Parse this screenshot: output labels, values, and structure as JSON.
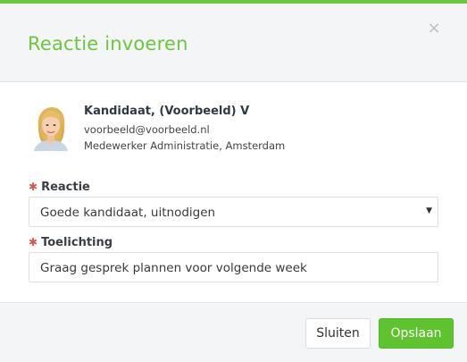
{
  "dialog": {
    "title": "Reactie invoeren",
    "close_glyph": "×",
    "accent_color": "#6bc83c"
  },
  "candidate": {
    "name": "Kandidaat, (Voorbeeld) V",
    "email": "voorbeeld@voorbeeld.nl",
    "role": "Medewerker Administratie, Amsterdam",
    "avatar_icon": "avatar-photo"
  },
  "form": {
    "required_marker": "✱",
    "reactie": {
      "label": "Reactie",
      "value": "Goede kandidaat, uitnodigen",
      "caret": "▼"
    },
    "toelichting": {
      "label": "Toelichting",
      "value": "Graag gesprek plannen voor volgende week"
    }
  },
  "footer": {
    "close_label": "Sluiten",
    "save_label": "Opslaan"
  }
}
